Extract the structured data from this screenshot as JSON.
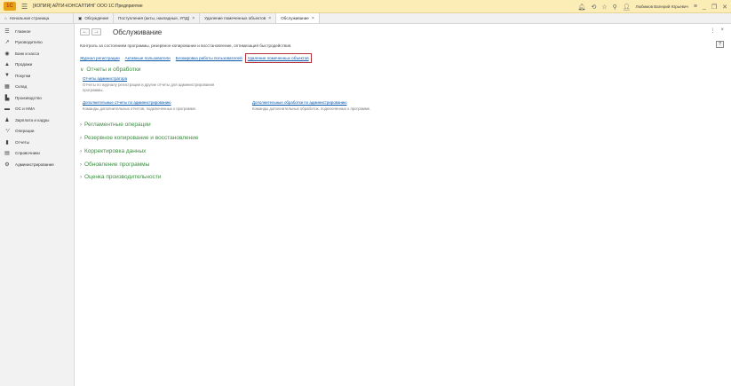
{
  "app": {
    "title": "[КОПИЯ] АЙТИ-КОНСАЛТИНГ ООО 1С:Предприятие",
    "user": "Любимов Валерий Юрьевич"
  },
  "tabs": [
    {
      "label": "Начальная страница"
    },
    {
      "label": "Обсуждения"
    },
    {
      "label": "Поступления (акты, накладные, УПД)"
    },
    {
      "label": "Удаление помеченных объектов"
    },
    {
      "label": "Обслуживание"
    }
  ],
  "sidebar": {
    "items": [
      {
        "label": "Главное",
        "icon": "hamburger-icon"
      },
      {
        "label": "Руководителю",
        "icon": "trend-icon"
      },
      {
        "label": "Банк и касса",
        "icon": "bank-icon"
      },
      {
        "label": "Продажи",
        "icon": "bag-icon"
      },
      {
        "label": "Покупки",
        "icon": "cart-icon"
      },
      {
        "label": "Склад",
        "icon": "warehouse-icon"
      },
      {
        "label": "Производство",
        "icon": "factory-icon"
      },
      {
        "label": "ОС и НМА",
        "icon": "truck-icon"
      },
      {
        "label": "Зарплата и кадры",
        "icon": "person-icon"
      },
      {
        "label": "Операции",
        "icon": "operations-icon"
      },
      {
        "label": "Отчеты",
        "icon": "chart-icon"
      },
      {
        "label": "Справочники",
        "icon": "book-icon"
      },
      {
        "label": "Администрирование",
        "icon": "gear-icon"
      }
    ]
  },
  "main": {
    "title": "Обслуживание",
    "description": "Контроль за состоянием программы, резервное копирование и восстановление, оптимизация быстродействия.",
    "help": "?",
    "top_links": [
      "Журнал регистрации",
      "Активные пользователи",
      "Блокировка работы пользователей",
      "Удаление помеченных объектов"
    ],
    "reports_section": {
      "title": "Отчеты и обработки",
      "admin_reports_link": "Отчеты администратора",
      "admin_reports_desc": "Отчеты по журналу регистрации и другие отчеты для администрирования программы.",
      "extra_reports_link": "Дополнительные отчеты по администрированию",
      "extra_reports_desc": "Команды дополнительных отчетов, подключенных к программе.",
      "extra_processing_link": "Дополнительные обработки по администрированию",
      "extra_processing_desc": "Команды дополнительных обработок, подключенных к программе."
    },
    "sections": [
      "Регламентные операции",
      "Резервное копирование и восстановление",
      "Корректировка данных",
      "Обновление программы",
      "Оценка производительности"
    ]
  }
}
